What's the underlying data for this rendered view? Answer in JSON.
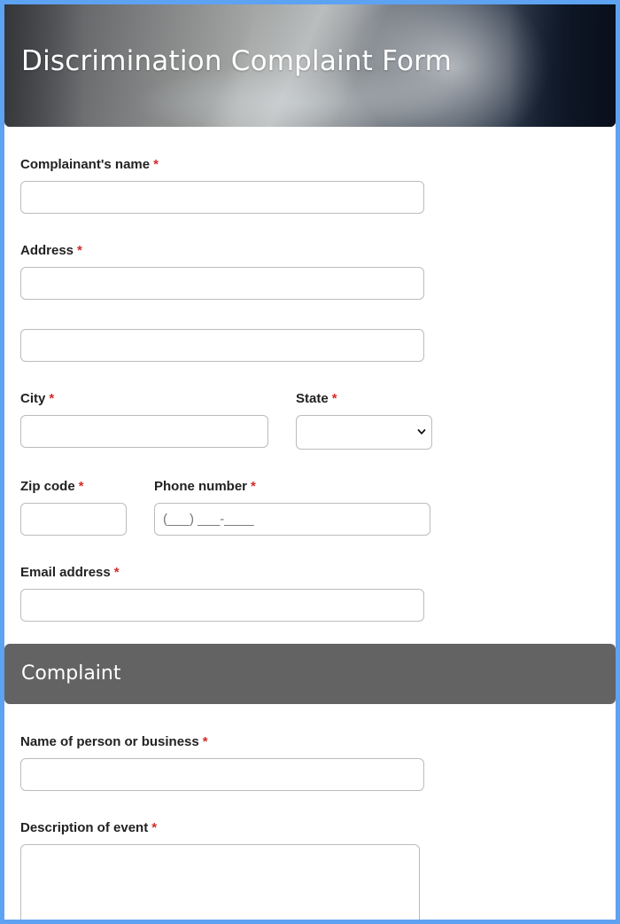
{
  "form": {
    "title": "Discrimination Complaint Form",
    "required_mark": "*",
    "colors": {
      "frame": "#5ea2f2",
      "section_bg": "#636363",
      "required": "#d42a2a"
    }
  },
  "fields": {
    "name": {
      "label": "Complainant's name",
      "value": ""
    },
    "address": {
      "label": "Address",
      "line1": "",
      "line2": ""
    },
    "city": {
      "label": "City",
      "value": ""
    },
    "state": {
      "label": "State",
      "value": ""
    },
    "zip": {
      "label": "Zip code",
      "value": ""
    },
    "phone": {
      "label": "Phone number",
      "placeholder": "(___) ___-____"
    },
    "email": {
      "label": "Email address",
      "value": ""
    }
  },
  "complaint_section": {
    "title": "Complaint",
    "person_business": {
      "label": "Name of person or business",
      "value": ""
    },
    "description": {
      "label": "Description of event",
      "value": ""
    }
  },
  "icons": {
    "select_arrow": "chevron-down-icon"
  }
}
